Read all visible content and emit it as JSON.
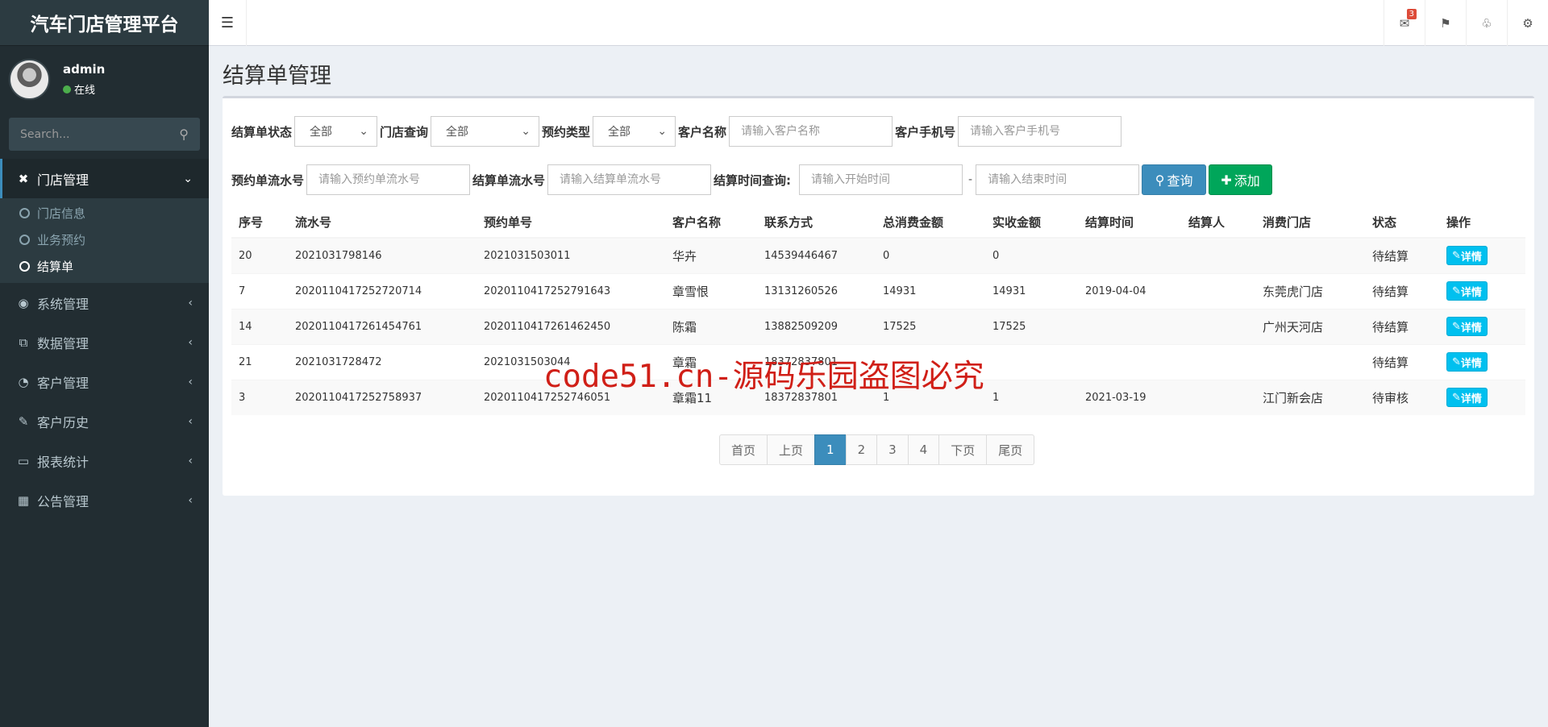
{
  "app": {
    "title": "汽车门店管理平台"
  },
  "user": {
    "name": "admin",
    "status": "在线"
  },
  "sidebar": {
    "search_placeholder": "Search...",
    "menu": [
      {
        "label": "门店管理",
        "icon": "wrench-icon",
        "expanded": true
      },
      {
        "label": "系统管理",
        "icon": "dashboard-icon"
      },
      {
        "label": "数据管理",
        "icon": "copy-icon"
      },
      {
        "label": "客户管理",
        "icon": "pie-chart-icon"
      },
      {
        "label": "客户历史",
        "icon": "edit-icon"
      },
      {
        "label": "报表统计",
        "icon": "laptop-icon"
      },
      {
        "label": "公告管理",
        "icon": "calendar-icon"
      }
    ],
    "submenu": [
      {
        "label": "门店信息"
      },
      {
        "label": "业务预约"
      },
      {
        "label": "结算单",
        "active": true
      }
    ]
  },
  "topbar": {
    "mail_badge": "3"
  },
  "page": {
    "title": "结算单管理"
  },
  "filters": {
    "status_label": "结算单状态",
    "status_value": "全部",
    "store_label": "门店查询",
    "store_value": "全部",
    "type_label": "预约类型",
    "type_value": "全部",
    "customer_label": "客户名称",
    "customer_placeholder": "请输入客户名称",
    "phone_label": "客户手机号",
    "phone_placeholder": "请输入客户手机号",
    "booking_no_label": "预约单流水号",
    "booking_no_placeholder": "请输入预约单流水号",
    "settle_no_label": "结算单流水号",
    "settle_no_placeholder": "请输入结算单流水号",
    "time_label": "结算时间查询:",
    "start_placeholder": "请输入开始时间",
    "dash": "-",
    "end_placeholder": "请输入结束时间",
    "query_button": "查询",
    "add_button": "添加"
  },
  "table": {
    "headers": [
      "序号",
      "流水号",
      "预约单号",
      "客户名称",
      "联系方式",
      "总消费金额",
      "实收金额",
      "结算时间",
      "结算人",
      "消费门店",
      "状态",
      "操作"
    ],
    "detail_label": "详情",
    "rows": [
      {
        "id": "20",
        "serial": "2021031798146",
        "booking": "2021031503011",
        "customer": "华卉",
        "phone": "14539446467",
        "total": "0",
        "paid": "0",
        "time": "",
        "operator": "",
        "store": "",
        "status": "待结算"
      },
      {
        "id": "7",
        "serial": "2020110417252720714",
        "booking": "2020110417252791643",
        "customer": "章雪恨",
        "phone": "13131260526",
        "total": "14931",
        "paid": "14931",
        "time": "2019-04-04",
        "operator": "",
        "store": "东莞虎门店",
        "status": "待结算"
      },
      {
        "id": "14",
        "serial": "2020110417261454761",
        "booking": "2020110417261462450",
        "customer": "陈霜",
        "phone": "13882509209",
        "total": "17525",
        "paid": "17525",
        "time": "",
        "operator": "",
        "store": "广州天河店",
        "status": "待结算"
      },
      {
        "id": "21",
        "serial": "2021031728472",
        "booking": "2021031503044",
        "customer": "章霜",
        "phone": "18372837801",
        "total": "",
        "paid": "",
        "time": "",
        "operator": "",
        "store": "",
        "status": "待结算"
      },
      {
        "id": "3",
        "serial": "2020110417252758937",
        "booking": "2020110417252746051",
        "customer": "章霜11",
        "phone": "18372837801",
        "total": "1",
        "paid": "1",
        "time": "2021-03-19",
        "operator": "",
        "store": "江门新会店",
        "status": "待审核"
      }
    ]
  },
  "pagination": {
    "first": "首页",
    "prev": "上页",
    "pages": [
      "1",
      "2",
      "3",
      "4"
    ],
    "current": "1",
    "next": "下页",
    "last": "尾页"
  },
  "watermark": "code51.cn-源码乐园盗图必究"
}
